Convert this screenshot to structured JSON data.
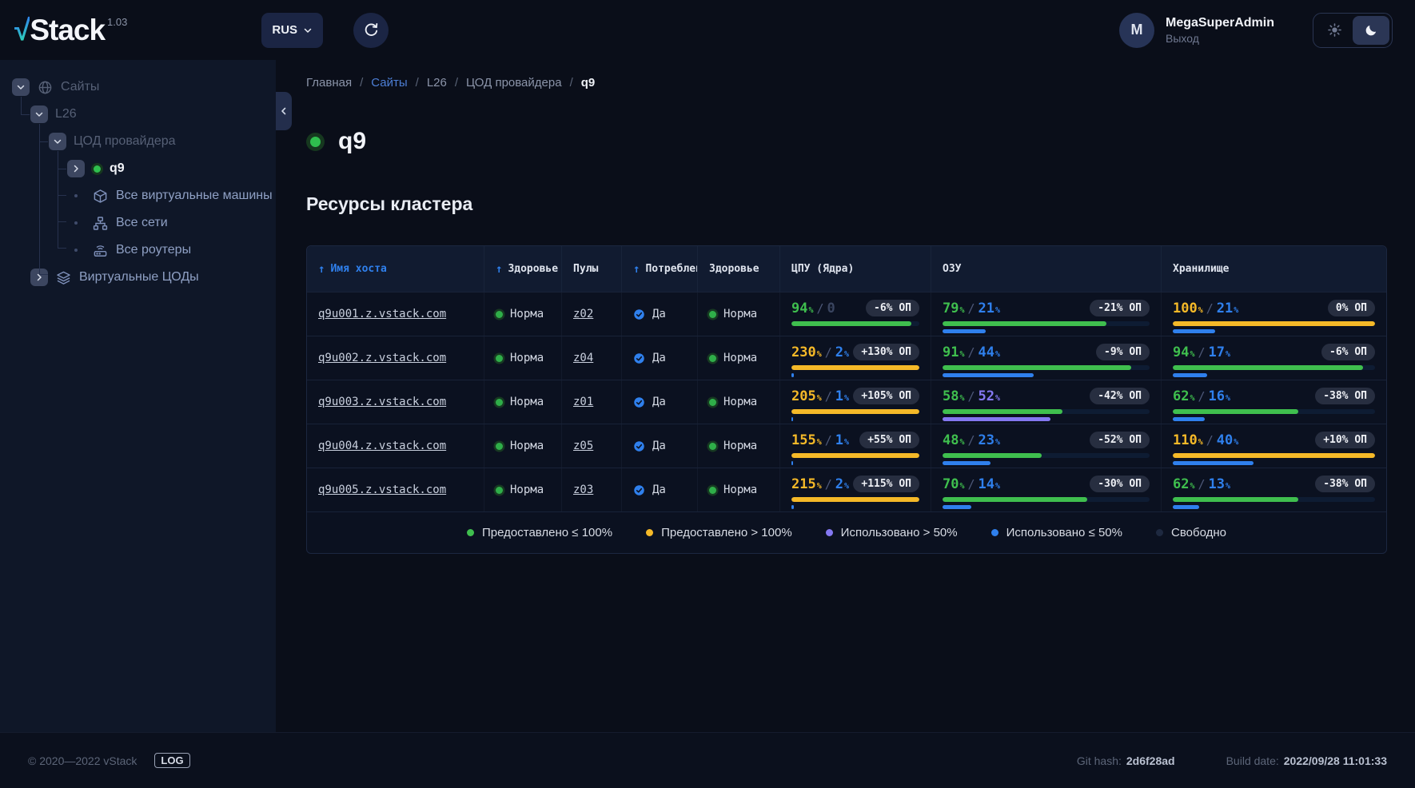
{
  "colors": {
    "accent_blue": "#2f80ed",
    "green": "#3fbf4e",
    "yellow": "#f5b928",
    "purple": "#8478f2",
    "free": "#1e2940",
    "status_ok": "#2fbf4e"
  },
  "header": {
    "logo_check": "√",
    "logo_text": "Stack",
    "version": "1.03",
    "lang": "RUS",
    "user": {
      "initial": "M",
      "name": "MegaSuperAdmin",
      "logout": "Выход"
    }
  },
  "sidebar": {
    "items": [
      {
        "label": "Сайты",
        "indent": 0,
        "toggle": "down",
        "icon": "globe",
        "style": "dim"
      },
      {
        "label": "L26",
        "indent": 1,
        "toggle": "down",
        "style": "dim"
      },
      {
        "label": "ЦОД провайдера",
        "indent": 2,
        "toggle": "down",
        "style": "dim"
      },
      {
        "label": "q9",
        "indent": 3,
        "toggle": "right",
        "dot": true,
        "style": "active"
      },
      {
        "label": "Все виртуальные машины",
        "indent": 3,
        "icon": "cube",
        "style": "link"
      },
      {
        "label": "Все сети",
        "indent": 3,
        "icon": "network",
        "style": "link"
      },
      {
        "label": "Все роутеры",
        "indent": 3,
        "icon": "router",
        "style": "link"
      },
      {
        "label": "Виртуальные ЦОДы",
        "indent": 1,
        "toggle": "right",
        "icon": "layers",
        "style": "link"
      }
    ]
  },
  "breadcrumb": {
    "items": [
      {
        "label": "Главная",
        "type": "plain"
      },
      {
        "label": "Сайты",
        "type": "link"
      },
      {
        "label": "L26",
        "type": "plain"
      },
      {
        "label": "ЦОД провайдера",
        "type": "plain"
      },
      {
        "label": "q9",
        "type": "current"
      }
    ]
  },
  "page": {
    "title": "q9",
    "section": "Ресурсы кластера"
  },
  "table": {
    "columns": [
      {
        "label": "Имя хоста",
        "sorted": true,
        "active": true
      },
      {
        "label": "Здоровье",
        "sorted": true
      },
      {
        "label": "Пулы"
      },
      {
        "label": "Потребление",
        "sorted": true
      },
      {
        "label": "Здоровье"
      },
      {
        "label": "ЦПУ (Ядра)"
      },
      {
        "label": "ОЗУ"
      },
      {
        "label": "Хранилище"
      }
    ],
    "rows": [
      {
        "host": "q9u001.z.vstack.com",
        "health": "Норма",
        "pool": "z02",
        "consumption": "Да",
        "health2": "Норма",
        "cpu": {
          "provided": 94,
          "used": 0,
          "badge": "-6% ОП"
        },
        "ram": {
          "provided": 79,
          "used": 21,
          "badge": "-21% ОП"
        },
        "storage": {
          "provided": 100,
          "used": 21,
          "badge": "0% ОП"
        }
      },
      {
        "host": "q9u002.z.vstack.com",
        "health": "Норма",
        "pool": "z04",
        "consumption": "Да",
        "health2": "Норма",
        "cpu": {
          "provided": 230,
          "used": 2,
          "badge": "+130% ОП"
        },
        "ram": {
          "provided": 91,
          "used": 44,
          "badge": "-9% ОП"
        },
        "storage": {
          "provided": 94,
          "used": 17,
          "badge": "-6% ОП"
        }
      },
      {
        "host": "q9u003.z.vstack.com",
        "health": "Норма",
        "pool": "z01",
        "consumption": "Да",
        "health2": "Норма",
        "cpu": {
          "provided": 205,
          "used": 1,
          "badge": "+105% ОП"
        },
        "ram": {
          "provided": 58,
          "used": 52,
          "badge": "-42% ОП"
        },
        "storage": {
          "provided": 62,
          "used": 16,
          "badge": "-38% ОП"
        }
      },
      {
        "host": "q9u004.z.vstack.com",
        "health": "Норма",
        "pool": "z05",
        "consumption": "Да",
        "health2": "Норма",
        "cpu": {
          "provided": 155,
          "used": 1,
          "badge": "+55% ОП"
        },
        "ram": {
          "provided": 48,
          "used": 23,
          "badge": "-52% ОП"
        },
        "storage": {
          "provided": 110,
          "used": 40,
          "badge": "+10% ОП"
        }
      },
      {
        "host": "q9u005.z.vstack.com",
        "health": "Норма",
        "pool": "z03",
        "consumption": "Да",
        "health2": "Норма",
        "cpu": {
          "provided": 215,
          "used": 2,
          "badge": "+115% ОП"
        },
        "ram": {
          "provided": 70,
          "used": 14,
          "badge": "-30% ОП"
        },
        "storage": {
          "provided": 62,
          "used": 13,
          "badge": "-38% ОП"
        }
      }
    ],
    "legend": [
      {
        "label": "Предоставлено ≤ 100%",
        "color": "#3fbf4e"
      },
      {
        "label": "Предоставлено > 100%",
        "color": "#f5b928"
      },
      {
        "label": "Использовано > 50%",
        "color": "#8478f2"
      },
      {
        "label": "Использовано ≤ 50%",
        "color": "#2f80ed"
      },
      {
        "label": "Свободно",
        "color": "#1e2940"
      }
    ]
  },
  "footer": {
    "copyright": "© 2020—2022 vStack",
    "log_badge": "LOG",
    "git_hash_label": "Git hash:",
    "git_hash": "2d6f28ad",
    "build_date_label": "Build date:",
    "build_date": "2022/09/28 11:01:33"
  }
}
